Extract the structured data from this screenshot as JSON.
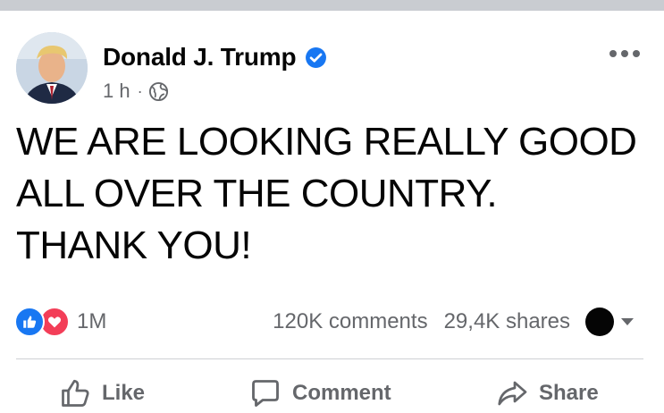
{
  "post": {
    "author": "Donald J. Trump",
    "verified": true,
    "timestamp": "1 h",
    "meta_separator": "·",
    "audience_icon": "globe-icon",
    "more_icon": "more-options-icon",
    "text_lines": [
      "WE ARE LOOKING REALLY GOOD",
      "ALL OVER THE COUNTRY.",
      "THANK YOU!"
    ]
  },
  "stats": {
    "reactions_icons": [
      "like-icon",
      "love-icon"
    ],
    "reactions_count": "1M",
    "comments": "120K comments",
    "shares": "29,4K shares"
  },
  "actions": {
    "like": "Like",
    "comment": "Comment",
    "share": "Share"
  },
  "colors": {
    "like_blue": "#1877f2",
    "love_red": "#f33e58",
    "secondary_text": "#65676b",
    "primary_text": "#050505"
  }
}
